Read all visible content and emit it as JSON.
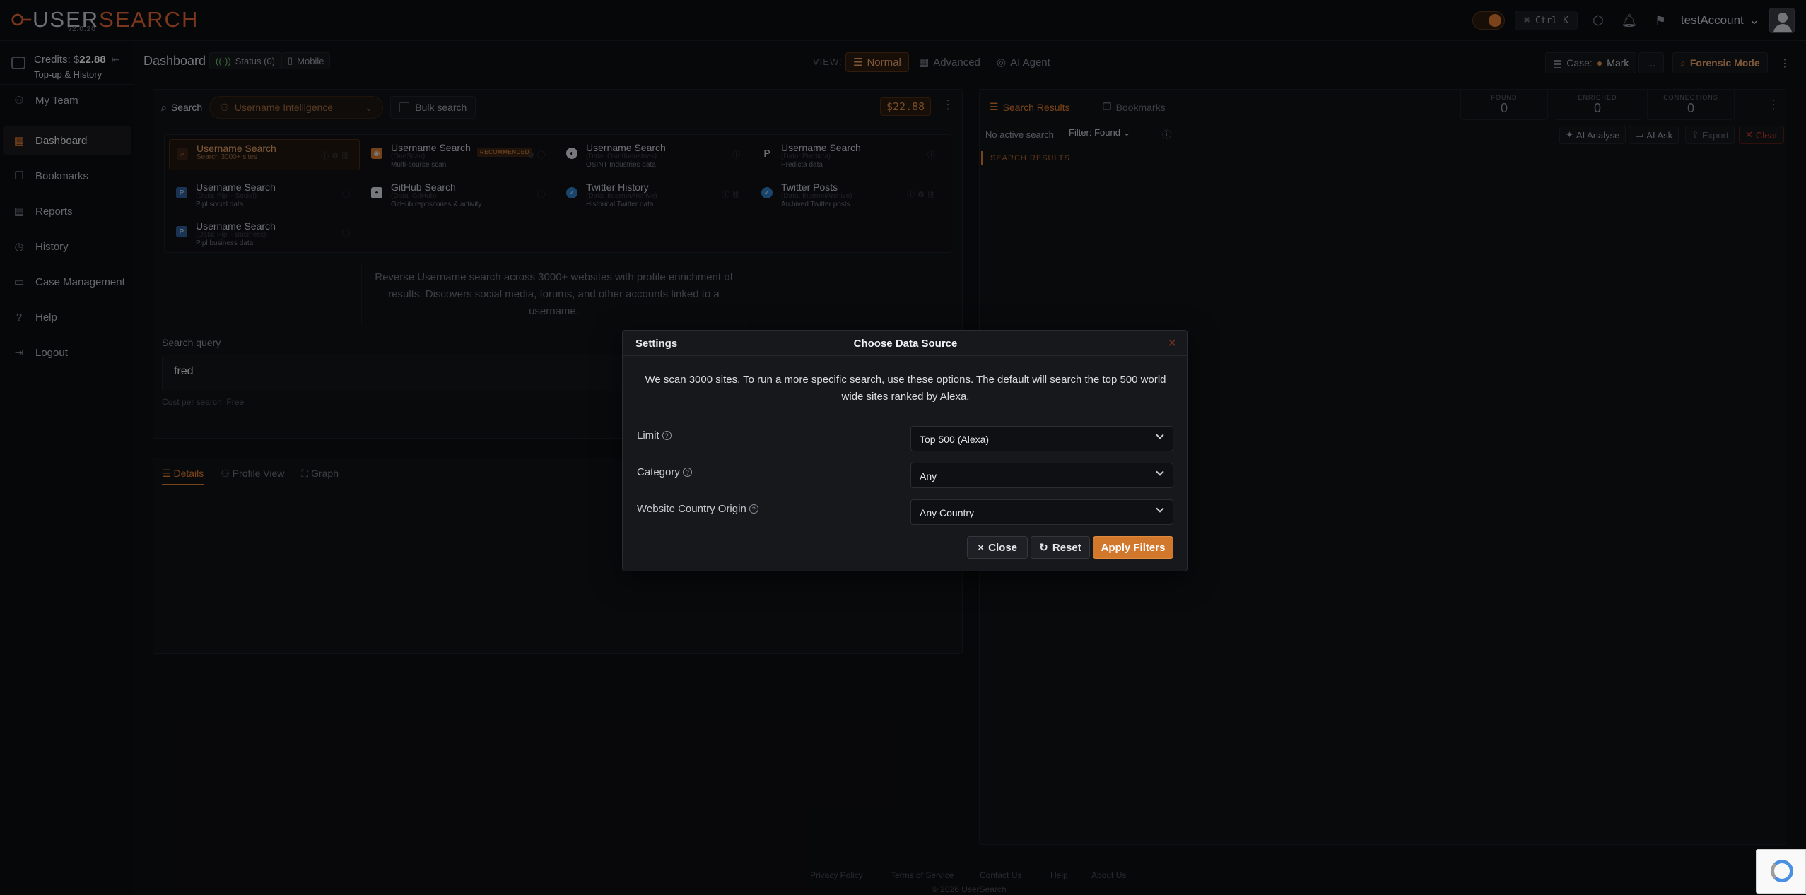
{
  "brand": {
    "name_a": "USER",
    "name_b": "SEARCH",
    "version": "v2.0.20"
  },
  "topbar": {
    "shortcut": "Ctrl K",
    "account": "testAccount"
  },
  "sidebar": {
    "credits_label": "Credits: $",
    "credits_value": "22.88",
    "topup": "Top-up & History",
    "items": [
      {
        "label": "My Team",
        "icon": "team-icon"
      },
      {
        "label": "Dashboard",
        "icon": "dashboard-icon"
      },
      {
        "label": "Bookmarks",
        "icon": "bookmark-icon"
      },
      {
        "label": "Reports",
        "icon": "report-icon"
      },
      {
        "label": "History",
        "icon": "history-icon"
      },
      {
        "label": "Case Management",
        "icon": "folder-icon"
      },
      {
        "label": "Help",
        "icon": "help-icon"
      },
      {
        "label": "Logout",
        "icon": "logout-icon"
      }
    ]
  },
  "header": {
    "title": "Dashboard",
    "status": "Status (0)",
    "mobile": "Mobile",
    "view_label": "VIEW:",
    "views": [
      "Normal",
      "Advanced",
      "AI Agent"
    ],
    "case_label": "Case:",
    "case_name": "Mark",
    "forensic": "Forensic Mode"
  },
  "search": {
    "tab": "Search",
    "category": "Username Intelligence",
    "bulk": "Bulk search",
    "price": "$22.88",
    "sources": [
      {
        "name": "Username Search",
        "meta": "Search 3000+ sites",
        "desc": ""
      },
      {
        "name": "Username Search",
        "meta": "(OneScan)",
        "desc": "Multi-source scan",
        "badge": "RECOMMENDED"
      },
      {
        "name": "Username Search",
        "meta": "(Data: OsintIndustries)",
        "desc": "OSINT Industries data"
      },
      {
        "name": "Username Search",
        "meta": "(Data: Predicta)",
        "desc": "Predicta data"
      },
      {
        "name": "Username Search",
        "meta": "(Data: Pipl - Social)",
        "desc": "Pipl social data"
      },
      {
        "name": "GitHub Search",
        "meta": "(Data: GitHub)",
        "desc": "GitHub repositories & activity"
      },
      {
        "name": "Twitter History",
        "meta": "(Data: InternetArchive)",
        "desc": "Historical Twitter data"
      },
      {
        "name": "Twitter Posts",
        "meta": "(Data: InternetArchive)",
        "desc": "Archived Twitter posts"
      },
      {
        "name": "Username Search",
        "meta": "(Data: Pipl - Business)",
        "desc": "Pipl business data"
      }
    ],
    "description": "Reverse Username search across 3000+ websites with profile enrichment of results. Discovers social media, forums, and other accounts linked to a username.",
    "query_label": "Search query",
    "query_value": "fred",
    "cost": "Cost per search: Free",
    "detail_tabs": [
      "Details",
      "Profile View",
      "Graph"
    ]
  },
  "results": {
    "tabs": [
      "Search Results",
      "Bookmarks"
    ],
    "stats": [
      {
        "label": "FOUND",
        "value": "0"
      },
      {
        "label": "ENRICHED",
        "value": "0"
      },
      {
        "label": "CONNECTIONS",
        "value": "0"
      }
    ],
    "no_active": "No active search",
    "filter": "Filter: Found",
    "ai_analyse": "AI Analyse",
    "ai_ask": "AI Ask",
    "export": "Export",
    "clear": "Clear",
    "section": "SEARCH RESULTS"
  },
  "modal": {
    "left_title": "Settings",
    "title": "Choose Data Source",
    "intro": "We scan 3000 sites. To run a more specific search, use these options. The default will search the top 500 world wide sites ranked by Alexa.",
    "limit_label": "Limit",
    "limit_value": "Top 500 (Alexa)",
    "category_label": "Category",
    "category_value": "Any",
    "country_label": "Website Country Origin",
    "country_value": "Any Country",
    "close": "Close",
    "reset": "Reset",
    "apply": "Apply Filters"
  },
  "footer": {
    "links": [
      "Privacy Policy",
      "Terms of Service",
      "Contact Us",
      "Help",
      "About Us"
    ],
    "copyright": "© 2026 UserSearch"
  }
}
